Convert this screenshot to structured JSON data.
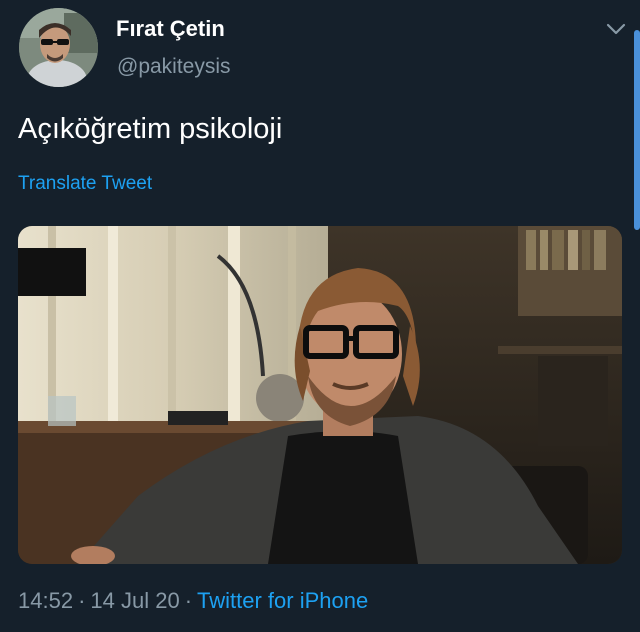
{
  "author": {
    "display_name": "Fırat Çetin",
    "handle": "@pakiteysis"
  },
  "tweet": {
    "text": "Açıköğretim psikoloji",
    "translate_label": "Translate Tweet"
  },
  "meta": {
    "time": "14:52",
    "date": "14 Jul 20",
    "separator": "·",
    "source": "Twitter for iPhone"
  },
  "icons": {
    "menu": "chevron-down-icon"
  },
  "colors": {
    "background": "#15202b",
    "primary_text": "#ffffff",
    "secondary_text": "#8899a6",
    "link": "#1da1f2"
  }
}
